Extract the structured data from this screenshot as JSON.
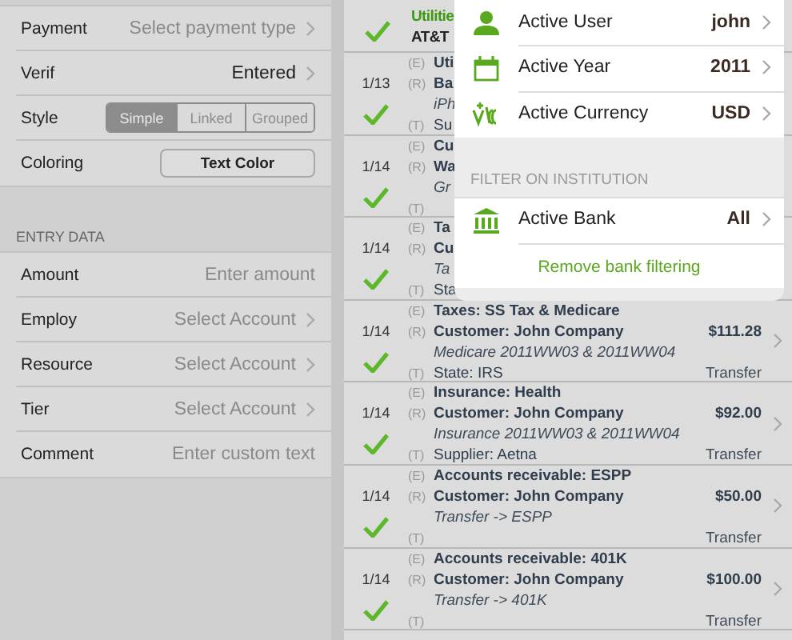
{
  "settings": {
    "rows": [
      {
        "kind": "picker",
        "label": "Payment",
        "placeholder": "Select payment type"
      },
      {
        "kind": "picker",
        "label": "Verif",
        "value": "Entered"
      },
      {
        "kind": "segmented",
        "label": "Style",
        "segments": [
          {
            "label": "Simple",
            "selected": true
          },
          {
            "label": "Linked",
            "selected": false
          },
          {
            "label": "Grouped",
            "selected": false
          }
        ]
      },
      {
        "kind": "button",
        "label": "Coloring",
        "button": "Text Color"
      }
    ]
  },
  "entry_data": {
    "header": "ENTRY DATA",
    "rows": [
      {
        "kind": "input",
        "label": "Amount",
        "placeholder": "Enter amount"
      },
      {
        "kind": "picker",
        "label": "Employ",
        "placeholder": "Select Account"
      },
      {
        "kind": "picker",
        "label": "Resource",
        "placeholder": "Select Account"
      },
      {
        "kind": "picker",
        "label": "Tier",
        "placeholder": "Select Account"
      },
      {
        "kind": "input",
        "label": "Comment",
        "placeholder": "Enter custom text"
      }
    ]
  },
  "transactions": [
    {
      "partial": true,
      "highlighted": true,
      "checked": true,
      "lines": [
        {
          "kind": "entry",
          "text": "Utilitie"
        },
        {
          "kind": "tag",
          "text": "AT&T"
        }
      ]
    },
    {
      "date": "1/13",
      "highlighted": false,
      "checked": true,
      "lines": [
        {
          "kind": "entry",
          "prefix": "(E)",
          "text": "Uti"
        },
        {
          "kind": "entry",
          "prefix": "(R)",
          "text": "Ba"
        },
        {
          "kind": "memo",
          "text": "iPh"
        },
        {
          "kind": "tag",
          "prefix": "(T)",
          "text": "Su"
        }
      ]
    },
    {
      "date": "1/14",
      "highlighted": false,
      "checked": true,
      "lines": [
        {
          "kind": "entry",
          "prefix": "(E)",
          "text": "Cu"
        },
        {
          "kind": "entry",
          "prefix": "(R)",
          "text": "Wa"
        },
        {
          "kind": "memo",
          "text": "Gr"
        },
        {
          "kind": "tag",
          "prefix": "(T)"
        }
      ]
    },
    {
      "date": "1/14",
      "highlighted": false,
      "checked": true,
      "lines": [
        {
          "kind": "entry",
          "prefix": "(E)",
          "text": "Ta"
        },
        {
          "kind": "entry",
          "prefix": "(R)",
          "text": "Cu"
        },
        {
          "kind": "memo",
          "text": "Ta"
        },
        {
          "kind": "tag",
          "prefix": "(T)",
          "text": "Sta"
        }
      ]
    },
    {
      "date": "1/14",
      "highlighted": false,
      "checked": true,
      "amount": "$111.28",
      "type": "Transfer",
      "lines": [
        {
          "kind": "entry",
          "prefix": "(E)",
          "text": "Taxes: SS Tax & Medicare"
        },
        {
          "kind": "entry",
          "prefix": "(R)",
          "text": "Customer: John Company"
        },
        {
          "kind": "memo",
          "text": "Medicare 2011WW03 & 2011WW04"
        },
        {
          "kind": "tag",
          "prefix": "(T)",
          "text": "State: IRS"
        }
      ]
    },
    {
      "date": "1/14",
      "highlighted": false,
      "checked": true,
      "amount": "$92.00",
      "type": "Transfer",
      "lines": [
        {
          "kind": "entry",
          "prefix": "(E)",
          "text": "Insurance: Health"
        },
        {
          "kind": "entry",
          "prefix": "(R)",
          "text": "Customer: John Company"
        },
        {
          "kind": "memo",
          "text": "Insurance 2011WW03 & 2011WW04"
        },
        {
          "kind": "tag",
          "prefix": "(T)",
          "text": "Supplier: Aetna"
        }
      ]
    },
    {
      "date": "1/14",
      "highlighted": false,
      "checked": true,
      "amount": "$50.00",
      "type": "Transfer",
      "lines": [
        {
          "kind": "entry",
          "prefix": "(E)",
          "text": "Accounts receivable: ESPP"
        },
        {
          "kind": "entry",
          "prefix": "(R)",
          "text": "Customer: John Company"
        },
        {
          "kind": "memo",
          "text": "Transfer -> ESPP"
        },
        {
          "kind": "tag",
          "prefix": "(T)"
        }
      ]
    },
    {
      "date": "1/14",
      "highlighted": false,
      "checked": true,
      "amount": "$100.00",
      "type": "Transfer",
      "lines": [
        {
          "kind": "entry",
          "prefix": "(E)",
          "text": "Accounts receivable: 401K"
        },
        {
          "kind": "entry",
          "prefix": "(R)",
          "text": "Customer: John Company"
        },
        {
          "kind": "memo",
          "text": "Transfer -> 401K"
        },
        {
          "kind": "tag",
          "prefix": "(T)"
        }
      ]
    }
  ],
  "popover": {
    "rows": [
      {
        "kind": "user",
        "label": "Active User",
        "value": "john"
      },
      {
        "kind": "year",
        "label": "Active Year",
        "value": "2011"
      },
      {
        "kind": "currency",
        "label": "Active Currency",
        "value": "USD"
      }
    ],
    "section_header": "FILTER ON INSTITUTION",
    "bank_rows": [
      {
        "kind": "bank",
        "label": "Active Bank",
        "value": "All"
      }
    ],
    "action": "Remove bank filtering"
  }
}
